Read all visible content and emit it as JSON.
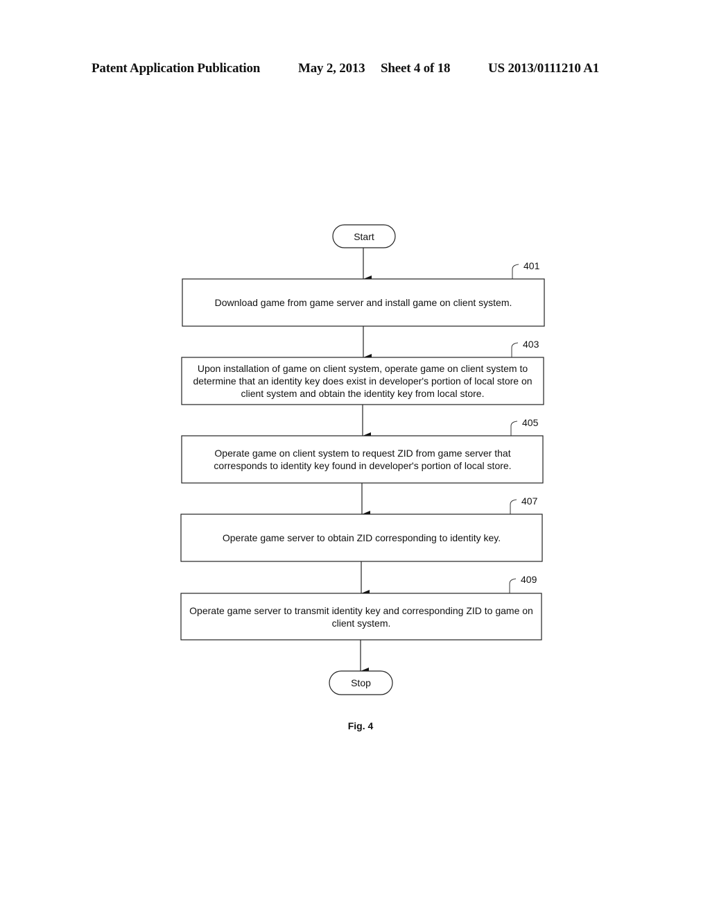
{
  "header": {
    "publication": "Patent Application Publication",
    "date": "May 2, 2013",
    "sheet": "Sheet 4 of 18",
    "number": "US 2013/0111210 A1"
  },
  "flowchart": {
    "start_label": "Start",
    "stop_label": "Stop",
    "steps": [
      {
        "ref": "401",
        "text": "Download game from game server and install game on client system."
      },
      {
        "ref": "403",
        "text": "Upon installation of game on client system, operate game on client system to determine that an identity key does exist in developer's portion of local store on client system and obtain the identity key from local store."
      },
      {
        "ref": "405",
        "text": "Operate game on client system to request ZID from game server that corresponds to identity key found in developer's portion of local store."
      },
      {
        "ref": "407",
        "text": "Operate game server to obtain ZID corresponding to identity key."
      },
      {
        "ref": "409",
        "text": "Operate game server to transmit identity key and corresponding ZID to game on client system."
      }
    ]
  },
  "figure_label": "Fig. 4"
}
